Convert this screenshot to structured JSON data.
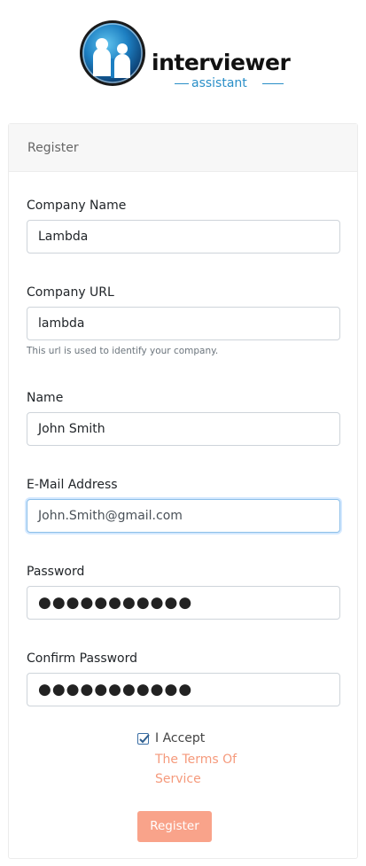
{
  "brand": {
    "name": "interviewer",
    "tagline": "assistant"
  },
  "card": {
    "title": "Register"
  },
  "form": {
    "company_name": {
      "label": "Company Name",
      "value": "Lambda"
    },
    "company_url": {
      "label": "Company URL",
      "value": "lambda",
      "help": "This url is used to identify your company."
    },
    "name": {
      "label": "Name",
      "value": "John Smith"
    },
    "email": {
      "label": "E-Mail Address",
      "value": "John.Smith@gmail.com"
    },
    "password": {
      "label": "Password",
      "value": "●●●●●●●●●●●"
    },
    "confirm_password": {
      "label": "Confirm Password",
      "value": "●●●●●●●●●●●"
    },
    "accept": {
      "checked": true,
      "label": "I Accept",
      "link": "The Terms Of Service"
    },
    "submit_label": "Register"
  },
  "colors": {
    "accent": "#f9a38a",
    "link": "#f59a7c",
    "brand_blue": "#2a8fc8",
    "focus": "#8cbfe8"
  },
  "icons": {
    "logo": "people-logo-icon",
    "check": "check-icon"
  }
}
